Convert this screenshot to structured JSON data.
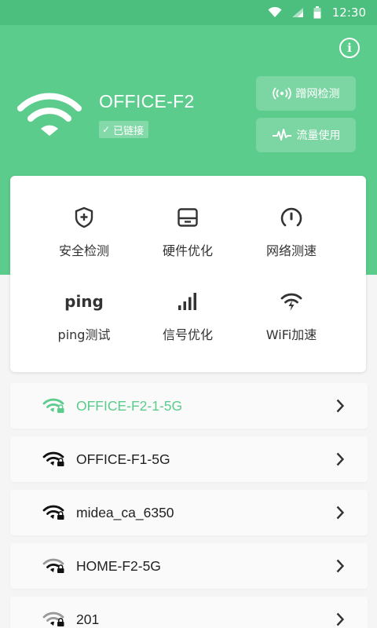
{
  "status_bar": {
    "time": "12:30"
  },
  "header": {
    "ssid": "OFFICE-F2",
    "connection_status": "已链接",
    "buttons": [
      {
        "label": "蹭网检测",
        "icon": "antenna-icon"
      },
      {
        "label": "流量使用",
        "icon": "pulse-icon"
      }
    ],
    "info_symbol": "i"
  },
  "tools": [
    {
      "label": "安全检测",
      "icon": "shield-plus-icon"
    },
    {
      "label": "硬件优化",
      "icon": "hardware-icon"
    },
    {
      "label": "网络测速",
      "icon": "speedometer-icon"
    },
    {
      "label": "ping测试",
      "icon": "ping-icon",
      "icon_text": "ping"
    },
    {
      "label": "信号优化",
      "icon": "signal-bars-icon"
    },
    {
      "label": "WiFi加速",
      "icon": "wifi-bolt-icon"
    }
  ],
  "networks": [
    {
      "name": "OFFICE-F2-1-5G",
      "active": true
    },
    {
      "name": "OFFICE-F1-5G",
      "active": false
    },
    {
      "name": "midea_ca_6350",
      "active": false
    },
    {
      "name": "HOME-F2-5G",
      "active": false
    },
    {
      "name": "201",
      "active": false
    }
  ],
  "colors": {
    "accent": "#5bcc8c",
    "status_bar": "#4cbf7e"
  }
}
